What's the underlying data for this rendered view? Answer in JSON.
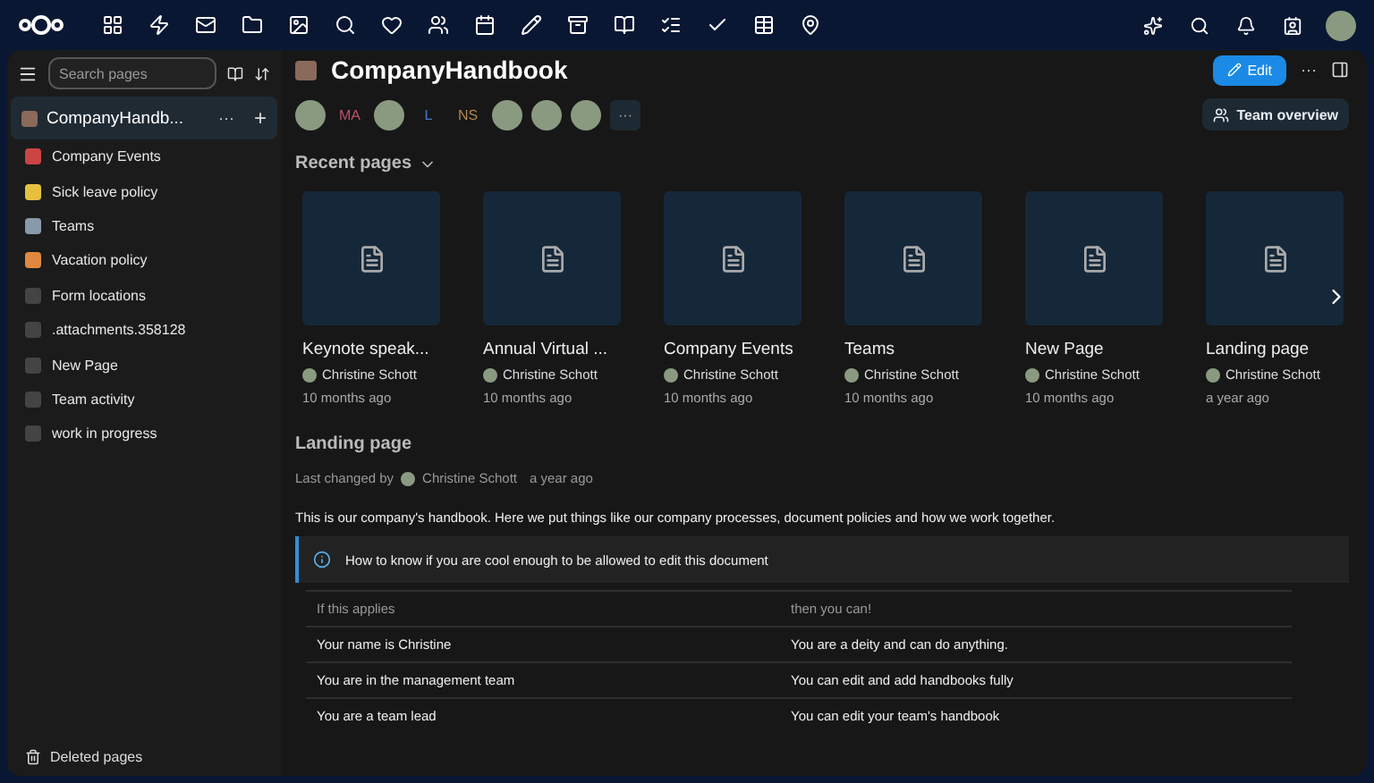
{
  "sidebar": {
    "search": {
      "placeholder": "Search pages"
    },
    "collective": {
      "title": "CompanyHandb...",
      "more": "···",
      "add": "+"
    },
    "items": [
      {
        "label": "Company Events"
      },
      {
        "label": "Sick leave policy"
      },
      {
        "label": "Teams"
      },
      {
        "label": "Vacation policy"
      },
      {
        "label": "Form locations"
      },
      {
        "label": ".attachments.358128"
      },
      {
        "label": "New Page"
      },
      {
        "label": "Team activity"
      },
      {
        "label": "work in progress"
      }
    ],
    "footer": "Deleted pages"
  },
  "header": {
    "title": "CompanyHandbook",
    "edit": "Edit",
    "more": "···",
    "team_overview": "Team overview"
  },
  "members": [
    {
      "kind": "photo"
    },
    {
      "kind": "initials",
      "initials": "MA",
      "color": "#c0506a"
    },
    {
      "kind": "photo"
    },
    {
      "kind": "initials",
      "initials": "L",
      "color": "#4a78c8"
    },
    {
      "kind": "initials",
      "initials": "NS",
      "color": "#b08850"
    },
    {
      "kind": "photo"
    },
    {
      "kind": "photo"
    },
    {
      "kind": "photo"
    },
    {
      "kind": "more",
      "initials": "···"
    }
  ],
  "recent": {
    "title": "Recent pages",
    "expanded": true,
    "cards": [
      {
        "title": "Keynote speak...",
        "author": "Christine Schott",
        "time": "10 months ago"
      },
      {
        "title": "Annual Virtual ...",
        "author": "Christine Schott",
        "time": "10 months ago"
      },
      {
        "title": "Company Events",
        "author": "Christine Schott",
        "time": "10 months ago"
      },
      {
        "title": "Teams",
        "author": "Christine Schott",
        "time": "10 months ago"
      },
      {
        "title": "New Page",
        "author": "Christine Schott",
        "time": "10 months ago"
      },
      {
        "title": "Landing page",
        "author": "Christine Schott",
        "time": "a year ago"
      }
    ]
  },
  "page": {
    "title": "Landing page",
    "changed_label": "Last changed by",
    "changed_by": "Christine Schott",
    "changed_time": "a year ago",
    "intro": "This is our company's handbook. Here we put things like our company processes, document policies and how we work together.",
    "callout": "How to know if you are cool enough to be allowed to edit this document",
    "table": {
      "columns": [
        "If this applies",
        "then you can!"
      ],
      "rows": [
        [
          "Your name is Christine",
          "You are a deity and can do anything."
        ],
        [
          "You are in the management team",
          "You can edit and add handbooks fully"
        ],
        [
          "You are a team lead",
          "You can edit your team's handbook"
        ]
      ]
    }
  }
}
